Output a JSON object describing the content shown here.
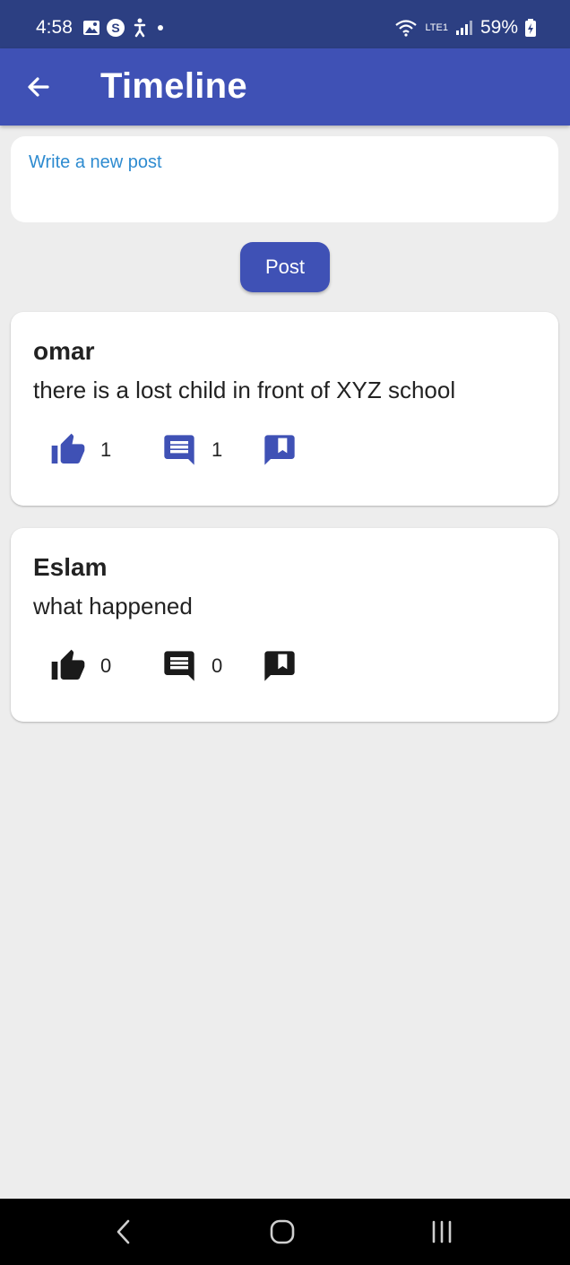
{
  "status_bar": {
    "time": "4:58",
    "battery": "59%",
    "network_label": "LTE1"
  },
  "app_bar": {
    "title": "Timeline",
    "back_icon": "arrow-left-icon"
  },
  "composer": {
    "placeholder": "Write a new post",
    "value": ""
  },
  "post_button_label": "Post",
  "posts": [
    {
      "author": "omar",
      "text": "there is a lost child in front of XYZ school",
      "likes": "1",
      "comments": "1",
      "icon_color": "#3f51b5"
    },
    {
      "author": "Eslam",
      "text": "what happened",
      "likes": "0",
      "comments": "0",
      "icon_color": "#1a1a1a"
    }
  ],
  "theme": {
    "primary": "#3f51b5",
    "status_bar": "#2c3f82",
    "background": "#ededed",
    "placeholder_color": "#2e8bd0"
  }
}
